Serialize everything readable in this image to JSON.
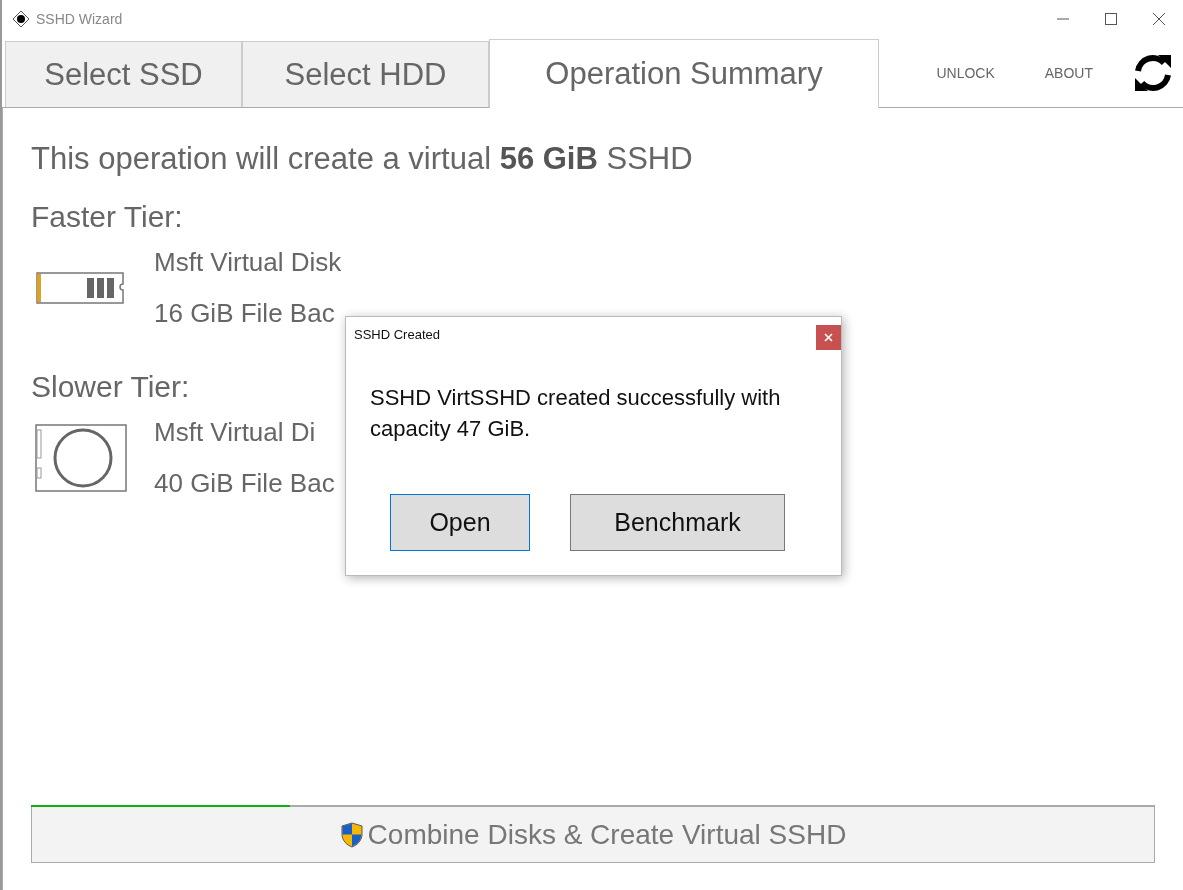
{
  "window": {
    "title": "SSHD Wizard"
  },
  "tabs": [
    {
      "label": "Select SSD",
      "selected": false
    },
    {
      "label": "Select HDD",
      "selected": false
    },
    {
      "label": "Operation Summary",
      "selected": true
    }
  ],
  "header_links": [
    "UNLOCK",
    "ABOUT"
  ],
  "summary": "This operation will create a virtual **56 GiB** SSHD",
  "tiers": [
    {
      "title": "Faster Tier:",
      "kind": "ssd",
      "name": "Msft Virtual Disk",
      "detail": "16 GiB File Bac"
    },
    {
      "title": "Slower Tier:",
      "kind": "hdd",
      "name": "Msft Virtual Di",
      "detail": "40 GiB File Bac"
    }
  ],
  "progress": {
    "level": 0.23
  },
  "action_button": {
    "label": "Combine Disks & Create Virtual SSHD"
  },
  "dialog": {
    "title": "SSHD Created",
    "message": "SSHD VirtSSHD created successfully with capacity 47 GiB.",
    "buttons": [
      {
        "label": "Open",
        "selected": true
      },
      {
        "label": "Benchmark",
        "selected": false
      }
    ]
  }
}
